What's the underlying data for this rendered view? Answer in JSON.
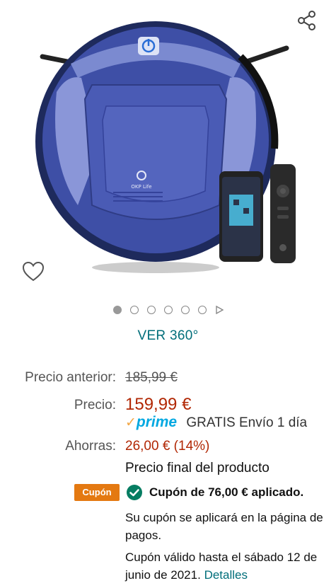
{
  "gallery": {
    "product_brand_text": "OKP Life",
    "share_icon": "share-icon",
    "favorite_icon": "heart-icon",
    "image_count": 6,
    "active_image": 1
  },
  "view360": {
    "label": "VER 360°"
  },
  "pricing": {
    "previous_label": "Precio anterior:",
    "previous_value": "185,99 €",
    "price_label": "Precio:",
    "price_value": "159,99 €",
    "prime_check": "✓",
    "prime_logo": "prime",
    "delivery": "GRATIS Envío 1 día",
    "savings_label": "Ahorras:",
    "savings_value": "26,00 € (14%)",
    "final_price_note": "Precio final del producto"
  },
  "coupon": {
    "badge": "Cupón",
    "applied": "Cupón de 76,00 € aplicado.",
    "note_line1": "Su cupón se aplicará en la página de pagos.",
    "validity": "Cupón válido hasta el sábado 12 de junio de 2021.",
    "details_link": "Detalles"
  },
  "colors": {
    "link": "#006e7a",
    "price": "#b12704",
    "coupon_badge": "#e47911",
    "prime": "#00a8e1",
    "check": "#067d62"
  }
}
